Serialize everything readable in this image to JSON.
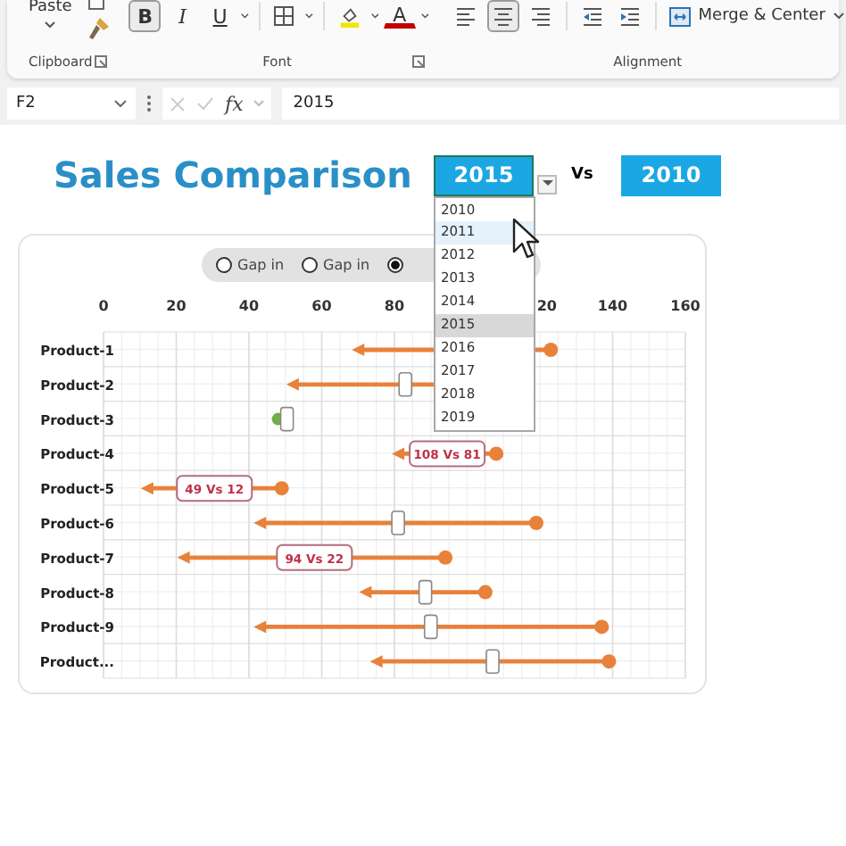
{
  "ribbon": {
    "paste_label": "Paste",
    "clipboard_label": "Clipboard",
    "font_label": "Font",
    "alignment_label": "Alignment",
    "font_buttons": [
      {
        "kind": "bold",
        "text": "B",
        "selected": true
      },
      {
        "kind": "italic",
        "text": "I",
        "selected": false
      },
      {
        "kind": "underline",
        "text": "U",
        "selected": false
      },
      {
        "kind": "borders",
        "selected": false
      },
      {
        "kind": "fill",
        "selected": false
      },
      {
        "kind": "font-color",
        "text": "A",
        "selected": false
      }
    ],
    "align_buttons": [
      {
        "kind": "left",
        "selected": false
      },
      {
        "kind": "center",
        "selected": true
      },
      {
        "kind": "right",
        "selected": false
      },
      {
        "kind": "outdent",
        "selected": false
      },
      {
        "kind": "indent",
        "selected": false
      }
    ],
    "merge_label": "Merge & Center"
  },
  "formula_bar": {
    "name_box": "F2",
    "fx": "fx",
    "value": "2015"
  },
  "title": "Sales Comparison",
  "year_selector": {
    "value": "2015",
    "options": [
      {
        "label": "2010",
        "selected": false,
        "hovered": false
      },
      {
        "label": "2011",
        "selected": false,
        "hovered": true
      },
      {
        "label": "2012",
        "selected": false,
        "hovered": false
      },
      {
        "label": "2013",
        "selected": false,
        "hovered": false
      },
      {
        "label": "2014",
        "selected": false,
        "hovered": false
      },
      {
        "label": "2015",
        "selected": true,
        "hovered": false
      },
      {
        "label": "2016",
        "selected": false,
        "hovered": false
      },
      {
        "label": "2017",
        "selected": false,
        "hovered": false
      },
      {
        "label": "2018",
        "selected": false,
        "hovered": false
      },
      {
        "label": "2019",
        "selected": false,
        "hovered": false
      }
    ]
  },
  "vs_label": "Vs",
  "compare_year": "2010",
  "chart": {
    "options": [
      {
        "label": "Gap in",
        "selected": false
      },
      {
        "label": "Gap in",
        "selected": false
      },
      {
        "selected": true
      }
    ],
    "chart_data": {
      "type": "scatter",
      "orientation": "horizontal",
      "grid": true,
      "categories": [
        "Product-1",
        "Product-2",
        "Product-3",
        "Product-4",
        "Product-5",
        "Product-6",
        "Product-7",
        "Product-8",
        "Product-9",
        "Product..."
      ],
      "xlim": [
        0,
        160
      ],
      "xticks": [
        0,
        {
          "value": 20,
          "label": "20"
        },
        40,
        60,
        80,
        140,
        160
      ],
      "series": [
        {
          "color": "#e8813a",
          "values": [
            123,
            null,
            null,
            108,
            49,
            119,
            94,
            105,
            137,
            139
          ]
        },
        {
          "color": "#e8813a",
          "values": [
            70,
            52,
            null,
            81,
            12,
            43,
            22,
            72,
            43,
            75
          ]
        },
        {
          "color": "#70ad47",
          "values": [
            null,
            null,
            48,
            null,
            null,
            null,
            null,
            null,
            null,
            null
          ]
        }
      ],
      "annotations": [
        {
          "y": "Product-4",
          "text": "108 Vs 81"
        },
        {
          "y": "Product-5",
          "text": "49 Vs 12"
        },
        {
          "y": "Product-7",
          "text": "94 Vs 22"
        }
      ]
    },
    "covered_tick_label": "20"
  }
}
